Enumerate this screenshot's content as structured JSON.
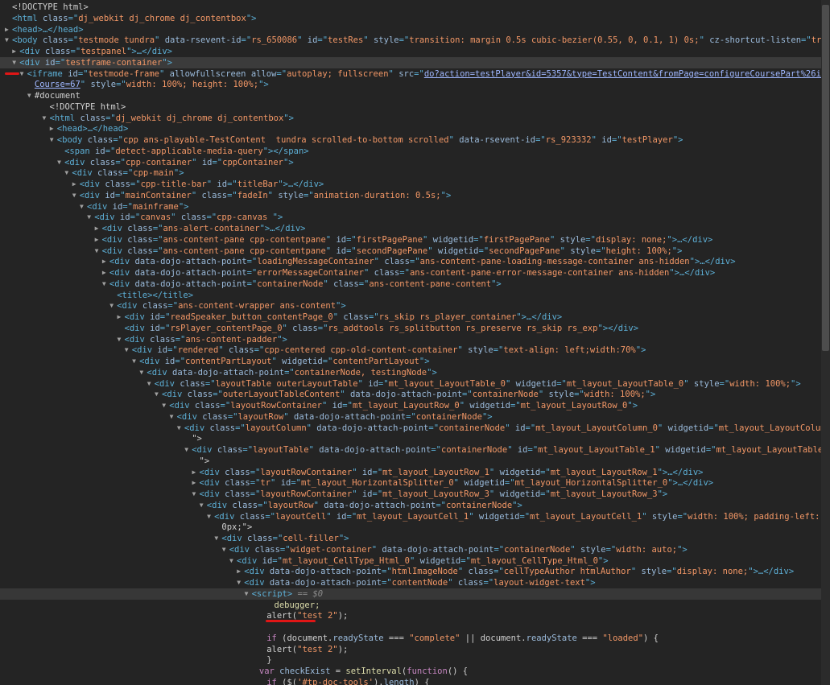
{
  "rows": [
    {
      "indent": 0,
      "arrow": "",
      "kind": "plain",
      "text": "<!DOCTYPE html>"
    },
    {
      "indent": 0,
      "arrow": "",
      "kind": "open",
      "tag": "html",
      "attrs": [
        [
          "class",
          "dj_webkit dj_chrome dj_contentbox"
        ]
      ],
      "tail": ">"
    },
    {
      "indent": 0,
      "arrow": "▶",
      "kind": "collapsed",
      "tag": "head",
      "attrs": [],
      "tail": ">…</head>"
    },
    {
      "indent": 0,
      "arrow": "▼",
      "kind": "open",
      "tag": "body",
      "attrs": [
        [
          "class",
          "testmode tundra"
        ],
        [
          "data-rsevent-id",
          "rs_650086"
        ],
        [
          "id",
          "testRes"
        ],
        [
          "style",
          "transition: margin 0.5s cubic-bezier(0.55, 0, 0.1, 1) 0s;"
        ],
        [
          "cz-shortcut-listen",
          "true"
        ]
      ],
      "tail": ">"
    },
    {
      "indent": 1,
      "arrow": "▶",
      "kind": "collapsed",
      "tag": "div",
      "attrs": [
        [
          "class",
          "testpanel"
        ]
      ],
      "tail": ">…</div>"
    },
    {
      "indent": 1,
      "arrow": "▼",
      "kind": "open",
      "tag": "div",
      "attrs": [
        [
          "id",
          "testframe-container"
        ]
      ],
      "tail": ">",
      "hl": true
    },
    {
      "indent": 2,
      "arrow": "▼",
      "kind": "iframe",
      "tag": "iframe",
      "attrs": [
        [
          "id",
          "testmode-frame"
        ],
        [
          "allowfullscreen",
          null
        ],
        [
          "allow",
          "autoplay; fullscreen"
        ]
      ],
      "src1": "do?action=testPlayer&id=5357&type=TestContent&fromPage=configureCoursePart%26id%3D2227%26type%3DLesson&addTo"
    },
    {
      "indent": 3,
      "arrow": "",
      "kind": "iframe2",
      "src2": "Course=67",
      "attrs": [
        [
          "style",
          "width: 100%; height: 100%;"
        ]
      ],
      "tail": ">"
    },
    {
      "indent": 3,
      "arrow": "▼",
      "kind": "plain",
      "text": "#document"
    },
    {
      "indent": 5,
      "arrow": "",
      "kind": "plain",
      "text": "<!DOCTYPE html>"
    },
    {
      "indent": 5,
      "arrow": "▼",
      "kind": "open",
      "tag": "html",
      "attrs": [
        [
          "class",
          "dj_webkit dj_chrome dj_contentbox"
        ]
      ],
      "tail": ">"
    },
    {
      "indent": 6,
      "arrow": "▶",
      "kind": "collapsed",
      "tag": "head",
      "attrs": [],
      "tail": ">…</head>"
    },
    {
      "indent": 6,
      "arrow": "▼",
      "kind": "open",
      "tag": "body",
      "attrs": [
        [
          "class",
          "cpp ans-playable-TestContent  tundra scrolled-to-bottom scrolled"
        ],
        [
          "data-rsevent-id",
          "rs_923332"
        ],
        [
          "id",
          "testPlayer"
        ]
      ],
      "tail": ">"
    },
    {
      "indent": 7,
      "arrow": "",
      "kind": "open",
      "tag": "span",
      "attrs": [
        [
          "id",
          "detect-applicable-media-query"
        ]
      ],
      "tail": "></span>"
    },
    {
      "indent": 7,
      "arrow": "▼",
      "kind": "open",
      "tag": "div",
      "attrs": [
        [
          "class",
          "cpp-container"
        ],
        [
          "id",
          "cppContainer"
        ]
      ],
      "tail": ">"
    },
    {
      "indent": 8,
      "arrow": "▼",
      "kind": "open",
      "tag": "div",
      "attrs": [
        [
          "class",
          "cpp-main"
        ]
      ],
      "tail": ">"
    },
    {
      "indent": 9,
      "arrow": "▶",
      "kind": "collapsed",
      "tag": "div",
      "attrs": [
        [
          "class",
          "cpp-title-bar"
        ],
        [
          "id",
          "titleBar"
        ]
      ],
      "tail": ">…</div>"
    },
    {
      "indent": 9,
      "arrow": "▼",
      "kind": "open",
      "tag": "div",
      "attrs": [
        [
          "id",
          "mainContainer"
        ],
        [
          "class",
          "fadeIn"
        ],
        [
          "style",
          "animation-duration: 0.5s;"
        ]
      ],
      "tail": ">"
    },
    {
      "indent": 10,
      "arrow": "▼",
      "kind": "open",
      "tag": "div",
      "attrs": [
        [
          "id",
          "mainframe"
        ]
      ],
      "tail": ">"
    },
    {
      "indent": 11,
      "arrow": "▼",
      "kind": "open",
      "tag": "div",
      "attrs": [
        [
          "id",
          "canvas"
        ],
        [
          "class",
          "cpp-canvas "
        ]
      ],
      "tail": ">"
    },
    {
      "indent": 12,
      "arrow": "▶",
      "kind": "collapsed",
      "tag": "div",
      "attrs": [
        [
          "class",
          "ans-alert-container"
        ]
      ],
      "tail": ">…</div>"
    },
    {
      "indent": 12,
      "arrow": "▶",
      "kind": "collapsed",
      "tag": "div",
      "attrs": [
        [
          "class",
          "ans-content-pane cpp-contentpane"
        ],
        [
          "id",
          "firstPagePane"
        ],
        [
          "widgetid",
          "firstPagePane"
        ],
        [
          "style",
          "display: none;"
        ]
      ],
      "tail": ">…</div>"
    },
    {
      "indent": 12,
      "arrow": "▼",
      "kind": "open",
      "tag": "div",
      "attrs": [
        [
          "class",
          "ans-content-pane cpp-contentpane"
        ],
        [
          "id",
          "secondPagePane"
        ],
        [
          "widgetid",
          "secondPagePane"
        ],
        [
          "style",
          "height: 100%;"
        ]
      ],
      "tail": ">"
    },
    {
      "indent": 13,
      "arrow": "▶",
      "kind": "collapsed",
      "tag": "div",
      "attrs": [
        [
          "data-dojo-attach-point",
          "loadingMessageContainer"
        ],
        [
          "class",
          "ans-content-pane-loading-message-container ans-hidden"
        ]
      ],
      "tail": ">…</div>"
    },
    {
      "indent": 13,
      "arrow": "▶",
      "kind": "collapsed",
      "tag": "div",
      "attrs": [
        [
          "data-dojo-attach-point",
          "errorMessageContainer"
        ],
        [
          "class",
          "ans-content-pane-error-message-container ans-hidden"
        ]
      ],
      "tail": ">…</div>"
    },
    {
      "indent": 13,
      "arrow": "▼",
      "kind": "open",
      "tag": "div",
      "attrs": [
        [
          "data-dojo-attach-point",
          "containerNode"
        ],
        [
          "class",
          "ans-content-pane-content"
        ]
      ],
      "tail": ">"
    },
    {
      "indent": 14,
      "arrow": "",
      "kind": "open",
      "tag": "title",
      "attrs": [],
      "tail": "></title>"
    },
    {
      "indent": 14,
      "arrow": "▼",
      "kind": "open",
      "tag": "div",
      "attrs": [
        [
          "class",
          "ans-content-wrapper ans-content"
        ]
      ],
      "tail": ">"
    },
    {
      "indent": 15,
      "arrow": "▶",
      "kind": "collapsed",
      "tag": "div",
      "attrs": [
        [
          "id",
          "readSpeaker_button_contentPage_0"
        ],
        [
          "class",
          "rs_skip rs_player_container"
        ]
      ],
      "tail": ">…</div>"
    },
    {
      "indent": 15,
      "arrow": "",
      "kind": "open",
      "tag": "div",
      "attrs": [
        [
          "id",
          "rsPlayer_contentPage_0"
        ],
        [
          "class",
          "rs_addtools rs_splitbutton rs_preserve rs_skip rs_exp"
        ]
      ],
      "tail": "></div>"
    },
    {
      "indent": 15,
      "arrow": "▼",
      "kind": "open",
      "tag": "div",
      "attrs": [
        [
          "class",
          "ans-content-padder"
        ]
      ],
      "tail": ">"
    },
    {
      "indent": 16,
      "arrow": "▼",
      "kind": "open",
      "tag": "div",
      "attrs": [
        [
          "id",
          "rendered"
        ],
        [
          "class",
          "cpp-centered cpp-old-content-container"
        ],
        [
          "style",
          "text-align: left;width:70%"
        ]
      ],
      "tail": ">"
    },
    {
      "indent": 17,
      "arrow": "▼",
      "kind": "open",
      "tag": "div",
      "attrs": [
        [
          "id",
          "contentPartLayout"
        ],
        [
          "widgetid",
          "contentPartLayout"
        ]
      ],
      "tail": ">"
    },
    {
      "indent": 18,
      "arrow": "▼",
      "kind": "open",
      "tag": "div",
      "attrs": [
        [
          "data-dojo-attach-point",
          "containerNode, testingNode"
        ]
      ],
      "tail": ">"
    },
    {
      "indent": 19,
      "arrow": "▼",
      "kind": "open",
      "tag": "div",
      "attrs": [
        [
          "class",
          "layoutTable outerLayoutTable"
        ],
        [
          "id",
          "mt_layout_LayoutTable_0"
        ],
        [
          "widgetid",
          "mt_layout_LayoutTable_0"
        ],
        [
          "style",
          "width: 100%;"
        ]
      ],
      "tail": ">"
    },
    {
      "indent": 20,
      "arrow": "▼",
      "kind": "open",
      "tag": "div",
      "attrs": [
        [
          "class",
          "outerLayoutTableContent"
        ],
        [
          "data-dojo-attach-point",
          "containerNode"
        ],
        [
          "style",
          "width: 100%;"
        ]
      ],
      "tail": ">"
    },
    {
      "indent": 21,
      "arrow": "▼",
      "kind": "open",
      "tag": "div",
      "attrs": [
        [
          "class",
          "layoutRowContainer"
        ],
        [
          "id",
          "mt_layout_LayoutRow_0"
        ],
        [
          "widgetid",
          "mt_layout_LayoutRow_0"
        ]
      ],
      "tail": ">"
    },
    {
      "indent": 22,
      "arrow": "▼",
      "kind": "open",
      "tag": "div",
      "attrs": [
        [
          "class",
          "layoutRow"
        ],
        [
          "data-dojo-attach-point",
          "containerNode"
        ]
      ],
      "tail": ">"
    },
    {
      "indent": 23,
      "arrow": "▼",
      "kind": "open",
      "tag": "div",
      "attrs": [
        [
          "class",
          "layoutColumn"
        ],
        [
          "data-dojo-attach-point",
          "containerNode"
        ],
        [
          "id",
          "mt_layout_LayoutColumn_0"
        ],
        [
          "widgetid",
          "mt_layout_LayoutColumn_0"
        ],
        [
          "style",
          "width: 100%;"
        ]
      ],
      "tail": ""
    },
    {
      "indent": 24,
      "arrow": "",
      "kind": "plain",
      "text": "\">"
    },
    {
      "indent": 24,
      "arrow": "▼",
      "kind": "open",
      "tag": "div",
      "attrs": [
        [
          "class",
          "layoutTable"
        ],
        [
          "data-dojo-attach-point",
          "containerNode"
        ],
        [
          "id",
          "mt_layout_LayoutTable_1"
        ],
        [
          "widgetid",
          "mt_layout_LayoutTable_1"
        ],
        [
          "style",
          "width: 100%;"
        ]
      ],
      "tail": ""
    },
    {
      "indent": 25,
      "arrow": "",
      "kind": "plain",
      "text": "\">"
    },
    {
      "indent": 25,
      "arrow": "▶",
      "kind": "collapsed",
      "tag": "div",
      "attrs": [
        [
          "class",
          "layoutRowContainer"
        ],
        [
          "id",
          "mt_layout_LayoutRow_1"
        ],
        [
          "widgetid",
          "mt_layout_LayoutRow_1"
        ]
      ],
      "tail": ">…</div>"
    },
    {
      "indent": 25,
      "arrow": "▶",
      "kind": "collapsed",
      "tag": "div",
      "attrs": [
        [
          "class",
          "tr"
        ],
        [
          "id",
          "mt_layout_HorizontalSplitter_0"
        ],
        [
          "widgetid",
          "mt_layout_HorizontalSplitter_0"
        ]
      ],
      "tail": ">…</div>"
    },
    {
      "indent": 25,
      "arrow": "▼",
      "kind": "open",
      "tag": "div",
      "attrs": [
        [
          "class",
          "layoutRowContainer"
        ],
        [
          "id",
          "mt_layout_LayoutRow_3"
        ],
        [
          "widgetid",
          "mt_layout_LayoutRow_3"
        ]
      ],
      "tail": ">"
    },
    {
      "indent": 26,
      "arrow": "▼",
      "kind": "open",
      "tag": "div",
      "attrs": [
        [
          "class",
          "layoutRow"
        ],
        [
          "data-dojo-attach-point",
          "containerNode"
        ]
      ],
      "tail": ">"
    },
    {
      "indent": 27,
      "arrow": "▼",
      "kind": "open",
      "tag": "div",
      "attrs": [
        [
          "class",
          "layoutCell"
        ],
        [
          "id",
          "mt_layout_LayoutCell_1"
        ],
        [
          "widgetid",
          "mt_layout_LayoutCell_1"
        ],
        [
          "style",
          "width: 100%; padding-left: 10px; padding-right: 1"
        ]
      ],
      "tail": ""
    },
    {
      "indent": 28,
      "arrow": "",
      "kind": "plain",
      "text": "0px;\">"
    },
    {
      "indent": 28,
      "arrow": "▼",
      "kind": "open",
      "tag": "div",
      "attrs": [
        [
          "class",
          "cell-filler"
        ]
      ],
      "tail": ">"
    },
    {
      "indent": 29,
      "arrow": "▼",
      "kind": "open",
      "tag": "div",
      "attrs": [
        [
          "class",
          "widget-container"
        ],
        [
          "data-dojo-attach-point",
          "containerNode"
        ],
        [
          "style",
          "width: auto;"
        ]
      ],
      "tail": ">"
    },
    {
      "indent": 30,
      "arrow": "▼",
      "kind": "open",
      "tag": "div",
      "attrs": [
        [
          "id",
          "mt_layout_CellType_Html_0"
        ],
        [
          "widgetid",
          "mt_layout_CellType_Html_0"
        ]
      ],
      "tail": ">"
    },
    {
      "indent": 31,
      "arrow": "▶",
      "kind": "collapsed",
      "tag": "div",
      "attrs": [
        [
          "data-dojo-attach-point",
          "htmlImageNode"
        ],
        [
          "class",
          "cellTypeAuthor htmlAuthor"
        ],
        [
          "style",
          "display: none;"
        ]
      ],
      "tail": ">…</div>"
    },
    {
      "indent": 31,
      "arrow": "▼",
      "kind": "open",
      "tag": "div",
      "attrs": [
        [
          "data-dojo-attach-point",
          "contentNode"
        ],
        [
          "class",
          "layout-widget-text"
        ]
      ],
      "tail": ">"
    },
    {
      "indent": 32,
      "arrow": "▼",
      "kind": "script",
      "tag": "script",
      "sel": true,
      "ref": "== $0"
    },
    {
      "indent": 35,
      "arrow": "",
      "kind": "code",
      "code": "debugger;",
      "style": "fn"
    },
    {
      "indent": 34,
      "arrow": "",
      "kind": "code",
      "code": "alert(\"test 2\");",
      "style": "mixed1"
    },
    {
      "indent": 34,
      "arrow": "",
      "kind": "code",
      "code": "",
      "style": "plain"
    },
    {
      "indent": 34,
      "arrow": "",
      "kind": "code",
      "code": "if (document.readyState === \"complete\" || document.readyState === \"loaded\") {",
      "style": "mixed2"
    },
    {
      "indent": 34,
      "arrow": "",
      "kind": "code",
      "code": "alert(\"test 2\");",
      "style": "mixed1"
    },
    {
      "indent": 34,
      "arrow": "",
      "kind": "code",
      "code": "}",
      "style": "plain"
    },
    {
      "indent": 33,
      "arrow": "",
      "kind": "code",
      "code": "var checkExist = setInterval(function() {",
      "style": "mixed3"
    },
    {
      "indent": 34,
      "arrow": "",
      "kind": "code",
      "code": "if ($('#tp-doc-tools').length) {",
      "style": "mixed4"
    }
  ],
  "marks": {
    "iframe_marker": "red-underline",
    "alert_marker": "red-underline"
  },
  "colors": {
    "background": "#242424",
    "tag": "#5db0d7",
    "attr": "#9bbbdc",
    "value": "#f29766",
    "highlight": "#e01616"
  }
}
